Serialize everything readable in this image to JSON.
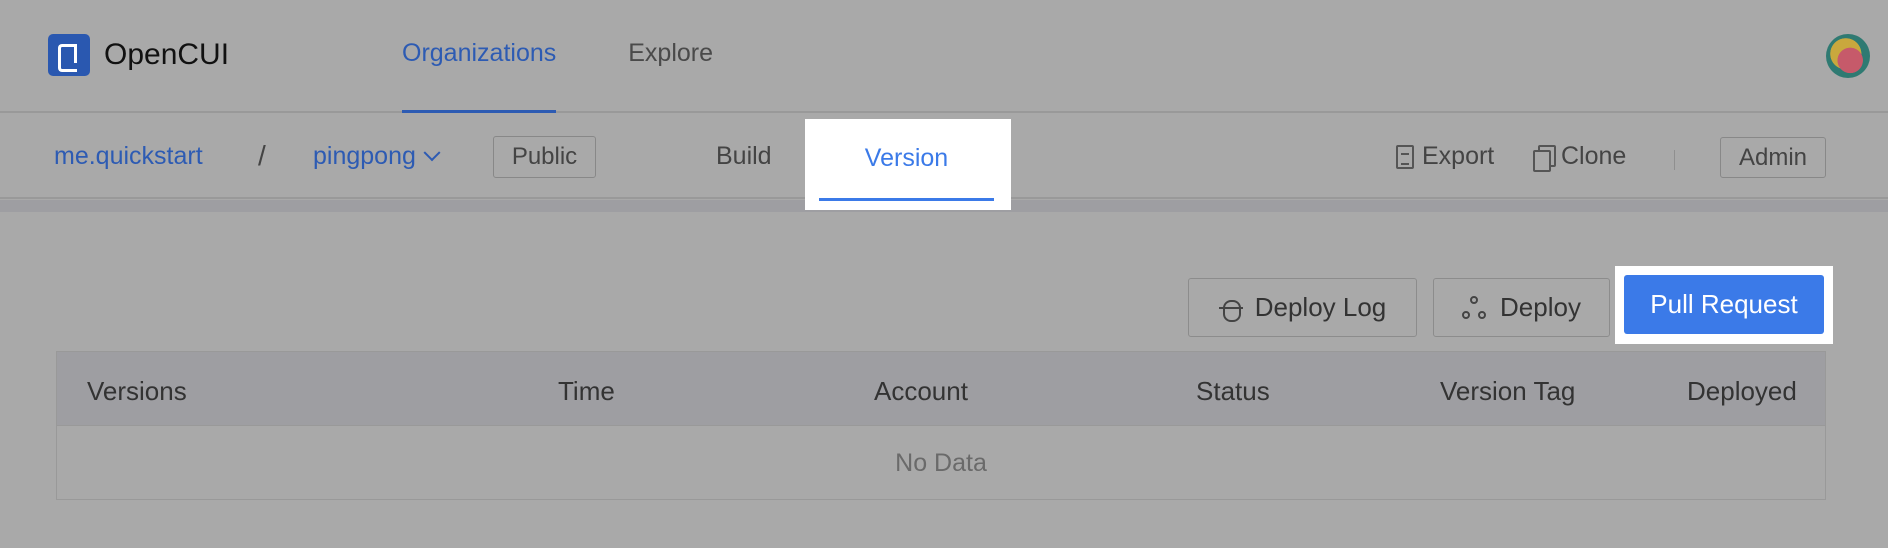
{
  "app": {
    "name": "OpenCUI"
  },
  "top_nav": [
    {
      "label": "Organizations",
      "active": true
    },
    {
      "label": "Explore",
      "active": false
    }
  ],
  "breadcrumb": {
    "org": "me.quickstart",
    "separator": "/",
    "project": "pingpong",
    "visibility": "Public"
  },
  "project_tabs": [
    {
      "label": "Build",
      "active": false
    },
    {
      "label": "Version",
      "active": true
    }
  ],
  "project_actions": {
    "export": "Export",
    "clone": "Clone",
    "admin": "Admin"
  },
  "toolbar": {
    "deploy_log": "Deploy Log",
    "deploy": "Deploy",
    "pull_request": "Pull Request"
  },
  "table": {
    "columns": [
      "Versions",
      "Time",
      "Account",
      "Status",
      "Version Tag",
      "Deployed"
    ],
    "rows": [],
    "empty_text": "No Data"
  },
  "colors": {
    "accent": "#3b7ae8",
    "brand": "#2a58b0",
    "overlay": "#a9a9a9"
  }
}
